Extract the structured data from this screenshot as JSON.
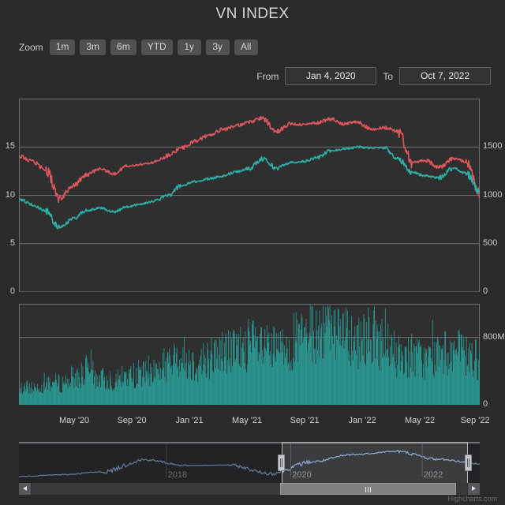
{
  "title": "VN INDEX",
  "range_selector": {
    "label": "Zoom",
    "buttons": [
      {
        "label": "1m",
        "selected": false
      },
      {
        "label": "3m",
        "selected": false
      },
      {
        "label": "6m",
        "selected": false
      },
      {
        "label": "YTD",
        "selected": false
      },
      {
        "label": "1y",
        "selected": false
      },
      {
        "label": "3y",
        "selected": false
      },
      {
        "label": "All",
        "selected": false
      }
    ]
  },
  "range_inputs": {
    "from_label": "From",
    "from_value": "Jan 4, 2020",
    "to_label": "To",
    "to_value": "Oct 7, 2022"
  },
  "navigator": {
    "year_labels": [
      "2018",
      "2020",
      "2022"
    ],
    "handle_left_pct": 57.0,
    "handle_right_pct": 97.5
  },
  "scrollbar": {
    "thumb_start_pct": 57.0,
    "thumb_end_pct": 97.5,
    "left_arrow": "scroll-left-arrow",
    "right_arrow": "scroll-right-arrow"
  },
  "credit": "Highcharts.com",
  "colors": {
    "background": "#2a2a2b",
    "plot_background": "#2f2f30",
    "gridline": "#707073",
    "series_red": "#e0575b",
    "series_teal": "#2eb0a8",
    "volume_teal": "#2a9d96",
    "navigator_line": "#8ca9d6",
    "text": "#e0e0e3"
  },
  "chart_data": [
    {
      "type": "line",
      "title": "VN INDEX",
      "name": "price-panel",
      "xlabel": "",
      "ylabel": "",
      "grid": true,
      "legend_position": "none",
      "x_axis": {
        "tick_labels": [
          "May '20",
          "Sep '20",
          "Jan '21",
          "May '21",
          "Sep '21",
          "Jan '22",
          "May '22",
          "Sep '22"
        ],
        "tick_positions_pct": [
          12.0,
          24.5,
          37.0,
          49.5,
          62.0,
          74.5,
          87.0,
          99.0
        ],
        "range": [
          "Jan 4, 2020",
          "Oct 7, 2022"
        ]
      },
      "y_axis_left": {
        "tick_labels": [
          "0",
          "5",
          "10",
          "15"
        ],
        "values": [
          0,
          5,
          10,
          15
        ],
        "ylim": [
          0,
          20
        ]
      },
      "y_axis_right": {
        "tick_labels": [
          "0",
          "500",
          "1000",
          "1500"
        ],
        "values": [
          0,
          500,
          1000,
          1500
        ],
        "ylim": [
          0,
          2000
        ]
      },
      "series": [
        {
          "name": "series-red",
          "axis": "left",
          "color": "#e0575b",
          "unit": "P/E",
          "x": [
            "2020-01",
            "2020-02",
            "2020-03-01",
            "2020-03-24",
            "2020-04",
            "2020-05",
            "2020-06",
            "2020-07",
            "2020-08",
            "2020-09",
            "2020-10",
            "2020-11",
            "2020-12",
            "2021-01",
            "2021-02",
            "2021-03",
            "2021-04",
            "2021-05",
            "2021-06",
            "2021-07",
            "2021-08",
            "2021-09",
            "2021-10",
            "2021-11",
            "2021-12",
            "2022-01",
            "2022-02",
            "2022-03",
            "2022-04",
            "2022-05",
            "2022-06",
            "2022-07",
            "2022-08",
            "2022-09",
            "2022-10-07"
          ],
          "values": [
            14.1,
            13.5,
            12.6,
            9.7,
            11.0,
            12.1,
            12.8,
            12.2,
            13.0,
            13.2,
            13.4,
            14.1,
            14.9,
            15.6,
            16.2,
            16.8,
            17.2,
            17.6,
            18.0,
            16.6,
            17.4,
            17.3,
            17.5,
            17.9,
            17.4,
            17.6,
            16.8,
            17.0,
            16.6,
            13.4,
            13.6,
            12.9,
            13.8,
            13.5,
            10.3
          ]
        },
        {
          "name": "series-teal",
          "axis": "right",
          "color": "#2eb0a8",
          "unit": "Index",
          "x": [
            "2020-01",
            "2020-02",
            "2020-03-01",
            "2020-03-24",
            "2020-04",
            "2020-05",
            "2020-06",
            "2020-07",
            "2020-08",
            "2020-09",
            "2020-10",
            "2020-11",
            "2020-12",
            "2021-01",
            "2021-02",
            "2021-03",
            "2021-04",
            "2021-05",
            "2021-06",
            "2021-07",
            "2021-08",
            "2021-09",
            "2021-10",
            "2021-11",
            "2021-12",
            "2022-01",
            "2022-02",
            "2022-03",
            "2022-04",
            "2022-05",
            "2022-06",
            "2022-07",
            "2022-08",
            "2022-09",
            "2022-10-07"
          ],
          "values": [
            965,
            900,
            835,
            660,
            760,
            840,
            870,
            830,
            880,
            910,
            940,
            1000,
            1100,
            1140,
            1170,
            1200,
            1240,
            1280,
            1380,
            1280,
            1340,
            1350,
            1390,
            1460,
            1480,
            1500,
            1490,
            1490,
            1370,
            1240,
            1200,
            1180,
            1280,
            1230,
            1035
          ]
        }
      ]
    },
    {
      "type": "bar",
      "name": "volume-panel",
      "title": "",
      "grid": true,
      "y_axis_right": {
        "tick_labels": [
          "0",
          "800M"
        ],
        "values": [
          0,
          800000000
        ],
        "ylim": [
          0,
          1200000000
        ]
      },
      "series": [
        {
          "name": "volume",
          "color": "#2a9d96",
          "unit": "shares",
          "categories": [
            "2020-01",
            "2020-02",
            "2020-03",
            "2020-04",
            "2020-05",
            "2020-06",
            "2020-07",
            "2020-08",
            "2020-09",
            "2020-10",
            "2020-11",
            "2020-12",
            "2021-01",
            "2021-02",
            "2021-03",
            "2021-04",
            "2021-05",
            "2021-06",
            "2021-07",
            "2021-08",
            "2021-09",
            "2021-10",
            "2021-11",
            "2021-12",
            "2022-01",
            "2022-02",
            "2022-03",
            "2022-04",
            "2022-05",
            "2022-06",
            "2022-07",
            "2022-08",
            "2022-09",
            "2022-10"
          ],
          "values": [
            180,
            200,
            260,
            250,
            310,
            370,
            300,
            290,
            330,
            360,
            400,
            480,
            560,
            480,
            540,
            620,
            620,
            700,
            640,
            620,
            720,
            760,
            880,
            1000,
            900,
            760,
            820,
            700,
            560,
            580,
            520,
            560,
            640,
            560,
            520
          ]
        }
      ]
    },
    {
      "type": "line",
      "name": "navigator-panel",
      "title": "",
      "grid": false,
      "x_axis": {
        "tick_labels": [
          "2018",
          "2020",
          "2022"
        ],
        "tick_positions_pct": [
          32.0,
          59.0,
          87.5
        ]
      },
      "series": [
        {
          "name": "navigator-series",
          "color": "#8ca9d6",
          "x": [
            "2015",
            "2016",
            "2017",
            "2018-03",
            "2018-07",
            "2019",
            "2020-03",
            "2020-12",
            "2021-06",
            "2022-01",
            "2022-06",
            "2022-10"
          ],
          "values": [
            545,
            610,
            720,
            1180,
            960,
            980,
            660,
            1100,
            1380,
            1500,
            1200,
            1035
          ]
        }
      ]
    }
  ]
}
